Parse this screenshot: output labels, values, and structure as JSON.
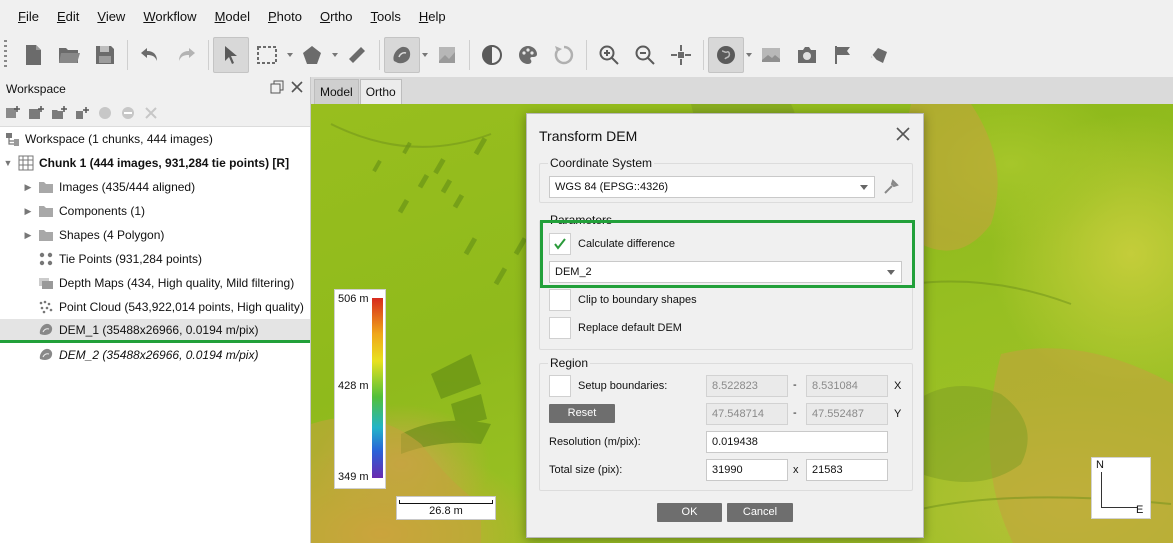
{
  "menu": [
    "File",
    "Edit",
    "View",
    "Workflow",
    "Model",
    "Photo",
    "Ortho",
    "Tools",
    "Help"
  ],
  "menu_underline": [
    "F",
    "E",
    "V",
    "W",
    "M",
    "P",
    "O",
    "T",
    "H"
  ],
  "workspace": {
    "title": "Workspace",
    "tree": [
      {
        "label": "Workspace (1 chunks, 444 images)",
        "icon": "workspace-icon"
      },
      {
        "label": "Chunk 1 (444 images, 931,284 tie points) [R]",
        "icon": "chunk-icon"
      },
      {
        "label": "Images (435/444 aligned)",
        "icon": "folder-icon"
      },
      {
        "label": "Components (1)",
        "icon": "folder-icon"
      },
      {
        "label": "Shapes (4 Polygon)",
        "icon": "folder-icon"
      },
      {
        "label": "Tie Points (931,284 points)",
        "icon": "tie-points-icon"
      },
      {
        "label": "Depth Maps (434, High quality, Mild filtering)",
        "icon": "depth-maps-icon"
      },
      {
        "label": "Point Cloud (543,922,014 points, High quality)",
        "icon": "point-cloud-icon"
      },
      {
        "label": "DEM_1 (35488x26966, 0.0194 m/pix)",
        "icon": "dem-icon"
      },
      {
        "label": "DEM_2 (35488x26966, 0.0194 m/pix)",
        "icon": "dem-icon"
      }
    ]
  },
  "tabs": [
    "Model",
    "Ortho"
  ],
  "legend": {
    "max": "506 m",
    "mid": "428 m",
    "min": "349 m"
  },
  "scale": "26.8 m",
  "compass": {
    "n": "N",
    "e": "E"
  },
  "dialog": {
    "title": "Transform DEM",
    "coord_group": "Coordinate System",
    "coord_value": "WGS 84 (EPSG::4326)",
    "params_group": "Parameters",
    "calc_diff": "Calculate difference",
    "dem_value": "DEM_2",
    "clip": "Clip to boundary shapes",
    "replace": "Replace default DEM",
    "region_group": "Region",
    "setup": "Setup boundaries:",
    "reset": "Reset",
    "x_min": "8.522823",
    "x_max": "8.531084",
    "y_min": "47.548714",
    "y_max": "47.552487",
    "dash": "-",
    "x_axis": "X",
    "y_axis": "Y",
    "resolution_label": "Resolution (m/pix):",
    "resolution": "0.019438",
    "total_label": "Total size (pix):",
    "total_w": "31990",
    "times": "x",
    "total_h": "21583",
    "ok": "OK",
    "cancel": "Cancel"
  },
  "colors": {
    "highlight": "#22a03a",
    "dialog_bg": "#f0f0f0",
    "button": "#6e6e6e"
  }
}
